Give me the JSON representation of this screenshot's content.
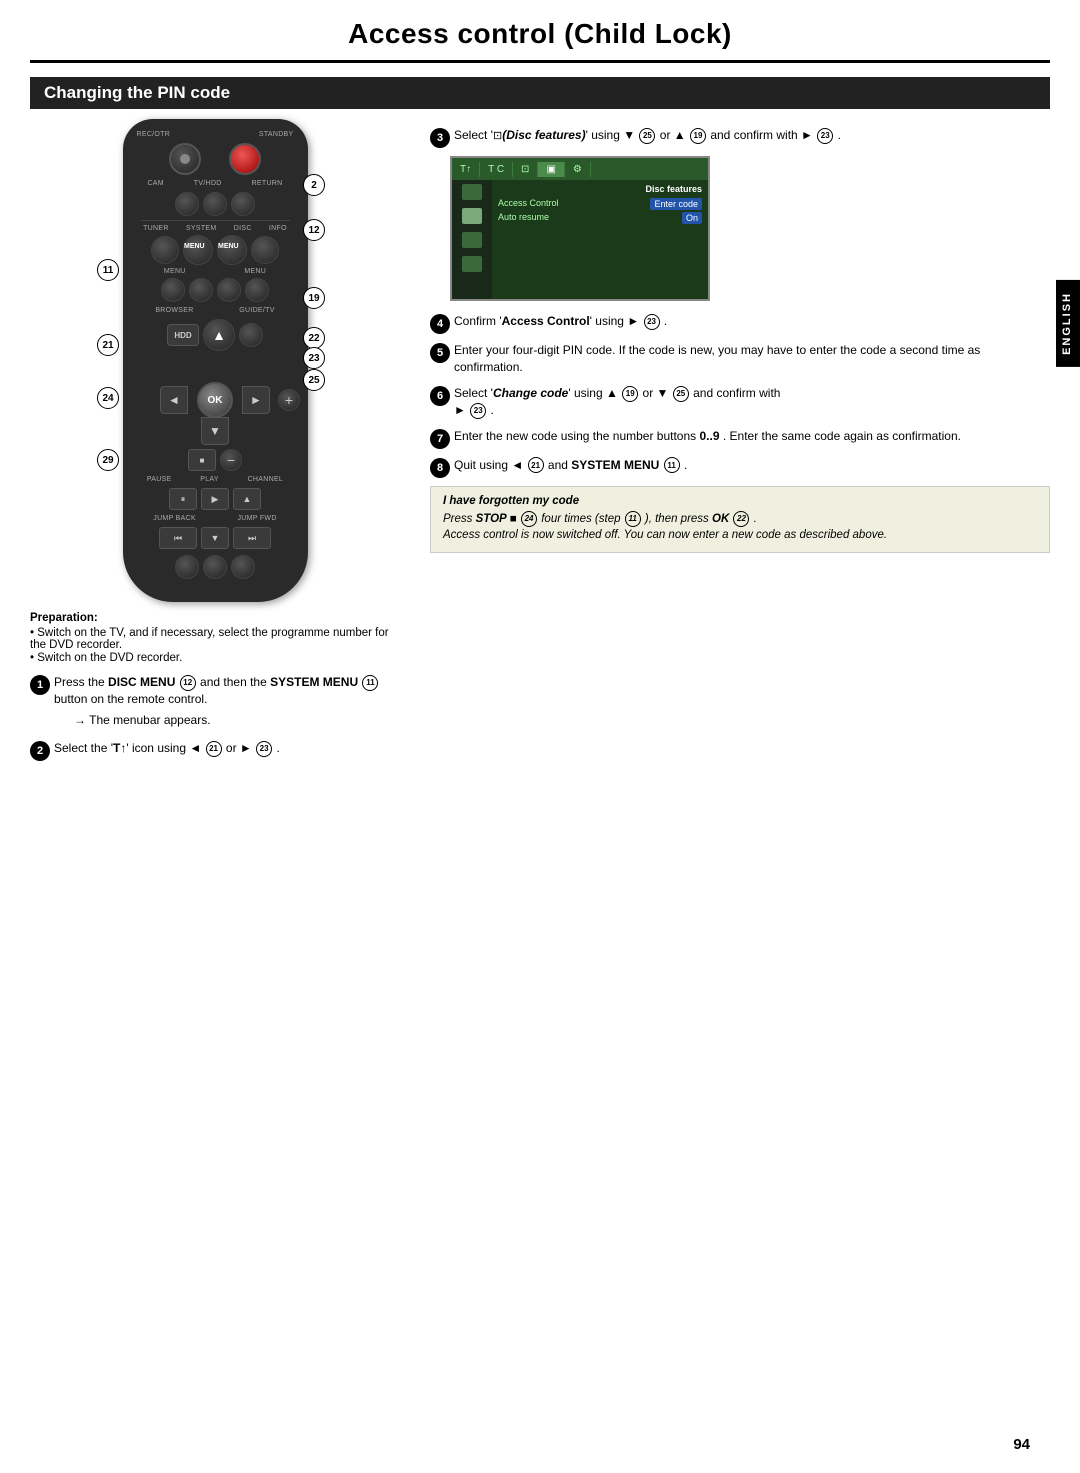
{
  "page": {
    "title": "Access control (Child Lock)",
    "page_number": "94",
    "section_title": "Changing the PIN code",
    "english_tab": "ENGLISH"
  },
  "preparation": {
    "title": "Preparation:",
    "lines": [
      "• Switch on the TV, and if necessary, select the programme number for the DVD recorder.",
      "• Switch on the DVD recorder."
    ]
  },
  "steps": {
    "step1_text": "Press the  DISC MENU",
    "step1_num": "12",
    "step1_cont": " and then the  SYSTEM MENU",
    "step1_num2": "11",
    "step1_end": " button on the remote control.",
    "step1_sub": "→ The menubar appears.",
    "step2_text": "Select the '",
    "step2_icon": "T↑",
    "step2_cont": "' icon using ◄",
    "step2_num1": "21",
    "step2_or": " or ►",
    "step2_num2": "23",
    "step2_end": " .",
    "step3_text": "Select '",
    "step3_icon": "⊡",
    "step3_italic": "(Disc features)",
    "step3_cont": "' using ▼",
    "step3_num1": "25",
    "step3_or": " or ▲",
    "step3_num2": "19",
    "step3_end": " and confirm with ►",
    "step3_num3": "23",
    "step3_end2": " .",
    "step4_text": "Confirm '",
    "step4_bold": "Access Control",
    "step4_cont": "' using ►",
    "step4_num": "23",
    "step4_end": " .",
    "step5_text": "Enter your four-digit PIN code. If the code is new, you may have to enter the code a second time as confirmation.",
    "step6_text": "Select '",
    "step6_bold": "Change code",
    "step6_cont": "' using ▲",
    "step6_num1": "19",
    "step6_or": " or ▼",
    "step6_num2": "25",
    "step6_end": " and confirm with ►",
    "step6_num3": "23",
    "step6_end2": " .",
    "step7_text": "Enter the new code using the number buttons  0..9 . Enter the same code again as confirmation.",
    "step8_text": "Quit using ◄",
    "step8_num1": "21",
    "step8_cont": " and  SYSTEM MENU",
    "step8_num2": "11",
    "step8_end": " ."
  },
  "screen": {
    "title": "Disc features",
    "rows": [
      {
        "label": "Access Control",
        "value": "Enter code"
      },
      {
        "label": "Auto resume",
        "value": "On"
      }
    ]
  },
  "info_box": {
    "title": "I have forgotten my code",
    "line1": "Press  STOP ■",
    "num1": "24",
    "line1b": " four times (step",
    "num2": "11",
    "line1c": " ), then press  OK",
    "num3": "22",
    "line1d": " .",
    "line2": "Access control is now switched off. You can now enter a new code as described above."
  },
  "remote": {
    "labels": {
      "rec_otr": "REC/OTR",
      "standby": "STANDBY",
      "cam": "CAM",
      "tv_hdd": "TV/HDD",
      "return": "RETURN",
      "tuner": "TUNER",
      "system": "SYSTEM",
      "disc": "DISC",
      "info": "INFO",
      "menu": "MENU",
      "browser": "BROWSER",
      "guide_tv": "GUIDE/TV",
      "hdd": "HDD",
      "stop": "STOP",
      "pause": "PAUSE",
      "play": "PLAY",
      "channel": "CHANNEL",
      "jump_back": "JUMP BACK",
      "jump_fwd": "JUMP FWD",
      "ok": "OK"
    },
    "callouts": {
      "c2": "2",
      "c11": "11",
      "c12": "12",
      "c19": "19",
      "c21": "21",
      "c22": "22",
      "c23": "23",
      "c24": "24",
      "c25": "25",
      "c29": "29"
    }
  }
}
